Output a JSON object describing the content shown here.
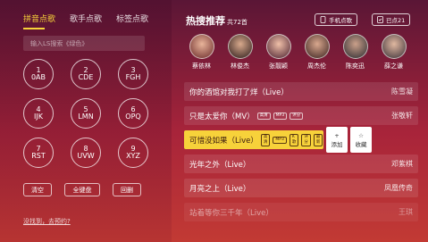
{
  "left": {
    "tabs": [
      "拼音点歌",
      "歌手点歌",
      "标签点歌"
    ],
    "search_placeholder": "输入LS搜索《绿色》",
    "keys": [
      {
        "num": "1",
        "letters": "0AB"
      },
      {
        "num": "2",
        "letters": "CDE"
      },
      {
        "num": "3",
        "letters": "FGH"
      },
      {
        "num": "4",
        "letters": "IJK"
      },
      {
        "num": "5",
        "letters": "LMN"
      },
      {
        "num": "6",
        "letters": "OPQ"
      },
      {
        "num": "7",
        "letters": "RST"
      },
      {
        "num": "8",
        "letters": "UVW"
      },
      {
        "num": "9",
        "letters": "XYZ"
      }
    ],
    "actions": [
      "清空",
      "全键盘",
      "回删"
    ],
    "not_found": "没找到，去预约?"
  },
  "right": {
    "title": "热搜推荐",
    "count": "共72首",
    "phone_button": "手机点歌",
    "selected_button": "已点21",
    "singers": [
      "蔡依林",
      "林俊杰",
      "张靓颖",
      "周杰伦",
      "陈奕迅",
      "薛之谦"
    ],
    "songs": [
      {
        "name": "你的酒馆对我打了烊（Live）",
        "artist": "陈雪凝",
        "badges": []
      },
      {
        "name": "只是太爱你（MV）",
        "artist": "张敬轩",
        "badges": [
          "高清",
          "MP3",
          "评分"
        ]
      },
      {
        "name": "可惜没如果（Live）",
        "artist": "",
        "badges": [
          "高清",
          "MP3",
          "K歌",
          "评分",
          "最新"
        ]
      },
      {
        "name": "光年之外（Live）",
        "artist": "邓紫棋",
        "badges": []
      },
      {
        "name": "月亮之上（Live）",
        "artist": "凤凰传奇",
        "badges": []
      },
      {
        "name": "站着等你三千年（Live）",
        "artist": "王琪",
        "badges": []
      }
    ],
    "row_add": "添加",
    "row_fav": "收藏",
    "add_symbol": "+",
    "fav_symbol": "☆"
  },
  "colors": {
    "accent": "#f7d23a",
    "bg_top": "#5a1636",
    "bg_bottom": "#c23a34"
  }
}
